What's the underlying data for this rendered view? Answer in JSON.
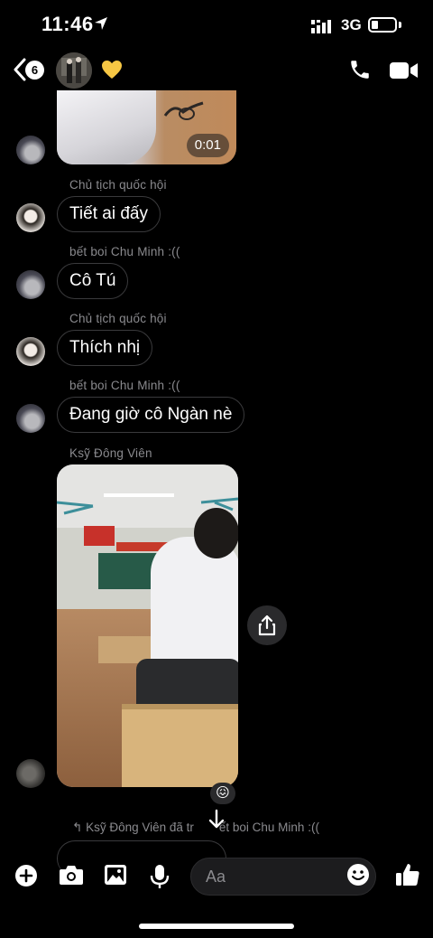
{
  "status_bar": {
    "time": "11:46",
    "network": "3G"
  },
  "header": {
    "back_badge": "6",
    "group_emoji": "💛",
    "icons": [
      "back-chevron-icon",
      "group-avatar",
      "heart-icon",
      "phone-icon",
      "video-icon"
    ]
  },
  "messages": [
    {
      "type": "video",
      "duration": "0:01"
    },
    {
      "sender": "Chủ tịch quốc hội",
      "text": "Tiết ai đấy"
    },
    {
      "sender": "bết boi Chu Minh :((",
      "text": "Cô Tú"
    },
    {
      "sender": "Chủ tịch quốc hội",
      "text": "Thích nhị"
    },
    {
      "sender": "bết boi Chu Minh :((",
      "text": "Đang giờ cô Ngàn nè"
    },
    {
      "sender": "Ksỹ Đông Viên",
      "type": "photo",
      "reaction": "😖"
    }
  ],
  "reply_note": {
    "left": "Ksỹ Đông Viên đã tr",
    "right": "ết boi Chu Minh :(("
  },
  "composer": {
    "placeholder": "Aa"
  },
  "colors": {
    "background": "#000000",
    "bubble_border": "#3a3a3c",
    "sender_text": "#8a8a8e",
    "heart": "#f7c744"
  }
}
